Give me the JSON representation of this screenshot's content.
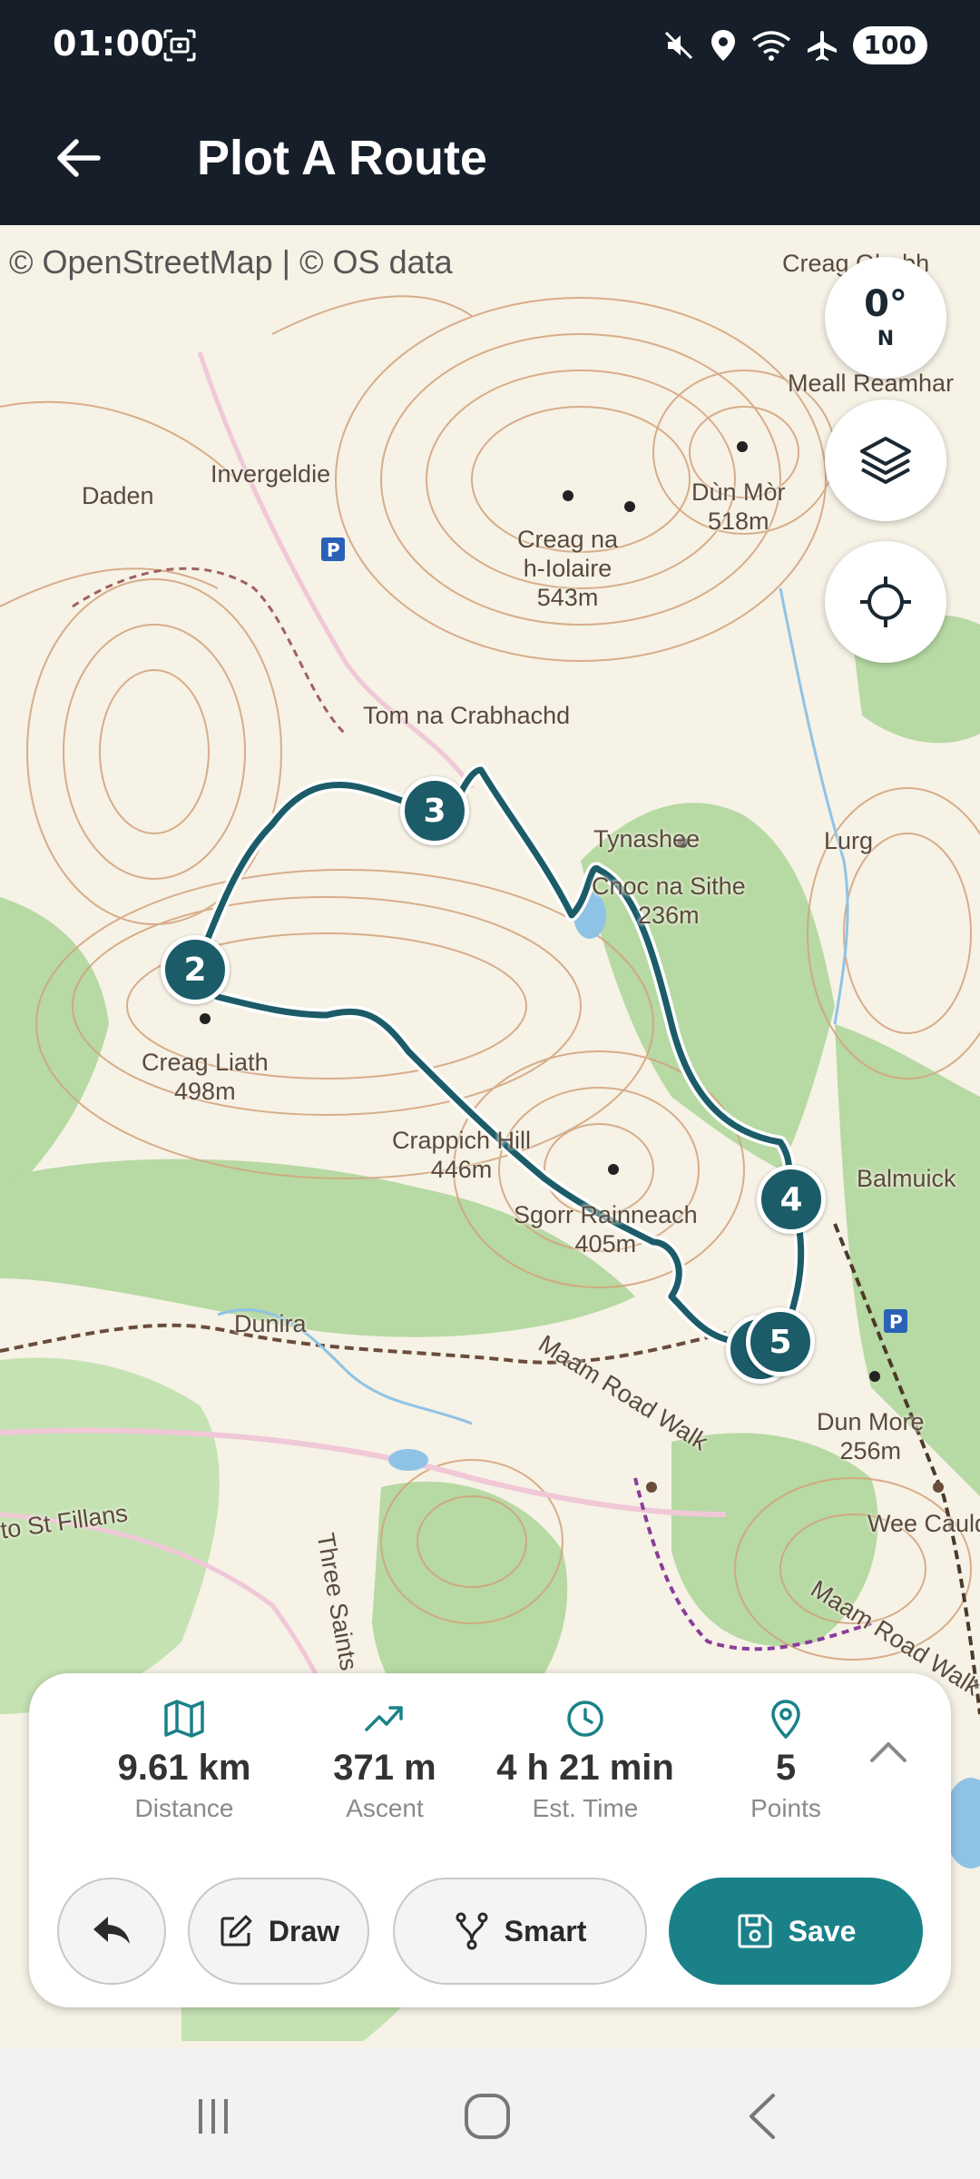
{
  "status_bar": {
    "time": "01:00",
    "battery": "100"
  },
  "app_bar": {
    "title": "Plot A Route"
  },
  "map": {
    "attribution": "© OpenStreetMap | © OS data",
    "compass": {
      "degrees": "0°",
      "direction": "N"
    },
    "labels": {
      "creag_ghabh": "Creag Ghabh",
      "meall_reamhar": "Meall Reamhar",
      "daden": "Daden",
      "invergeldie": "Invergeldie",
      "dun_mor": "Dùn Mòr",
      "dun_mor_height": "518m",
      "creag_na_hiolaire": "Creag na",
      "creag_na_hiolaire_2": "h-Iolaire",
      "creag_na_hiolaire_height": "543m",
      "tom_na_crabhachd": "Tom na Crabhachd",
      "tynashee": "Tynashee",
      "lurg": "Lurg",
      "cnoc_na_sithe": "Cnoc na Sithe",
      "cnoc_na_sithe_height": "236m",
      "creag_liath": "Creag Liath",
      "creag_liath_height": "498m",
      "crappich_hill": "Crappich Hill",
      "crappich_hill_height": "446m",
      "sgorr": "Sgorr Rainneach",
      "sgorr_height": "405m",
      "balmuick": "Balmuick",
      "dunira": "Dunira",
      "dun_more": "Dun More",
      "dun_more_height": "256m",
      "maam_road_walk": "Maam Road Walk",
      "maam_road_walk_2": "Maam Road Walk",
      "st_fillans": "to St Fillans",
      "three_saints": "Three Saints Way",
      "wee_cauldron": "Wee Cauldron"
    },
    "waypoints": [
      "2",
      "3",
      "4",
      "5"
    ]
  },
  "stats": [
    {
      "icon": "map-icon",
      "value": "9.61 km",
      "label": "Distance"
    },
    {
      "icon": "trend-up-icon",
      "value": "371 m",
      "label": "Ascent"
    },
    {
      "icon": "clock-icon",
      "value": "4 h 21 min",
      "label": "Est. Time"
    },
    {
      "icon": "map-pin-icon",
      "value": "5",
      "label": "Points"
    }
  ],
  "actions": {
    "draw": "Draw",
    "smart": "Smart",
    "save": "Save"
  },
  "colors": {
    "header": "#161f29",
    "route": "#1b5c68",
    "accent": "#1a8189"
  }
}
